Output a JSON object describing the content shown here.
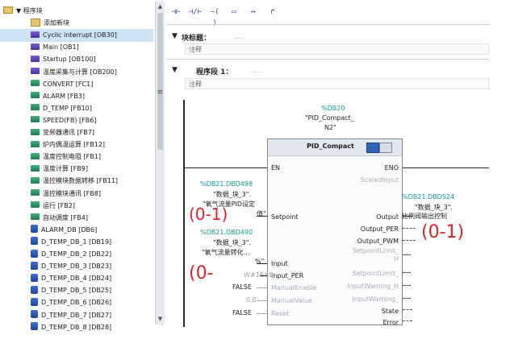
{
  "tree": {
    "items": [
      {
        "label": "▼ 程序块",
        "icon": "folder-icon",
        "kind": "folder",
        "indent": 4
      },
      {
        "label": "添加新块",
        "icon": "add-block-icon",
        "kind": "add",
        "indent": 38
      },
      {
        "label": "Cyclic interrupt [OB30]",
        "icon": "ob-icon",
        "kind": "ob",
        "indent": 38,
        "selected": true
      },
      {
        "label": "Main [OB1]",
        "icon": "ob-icon",
        "kind": "ob",
        "indent": 38
      },
      {
        "label": "Startup [OB100]",
        "icon": "ob-icon",
        "kind": "ob",
        "indent": 38
      },
      {
        "label": "温度采集与计算 [OB200]",
        "icon": "ob-icon",
        "kind": "ob",
        "indent": 38
      },
      {
        "label": "CONVERT [FC1]",
        "icon": "fc-icon",
        "kind": "fc",
        "indent": 38
      },
      {
        "label": "ALARM [FB3]",
        "icon": "fb-icon",
        "kind": "fb",
        "indent": 38
      },
      {
        "label": "D_TEMP [FB10]",
        "icon": "fb-icon",
        "kind": "fb",
        "indent": 38
      },
      {
        "label": "SPEED(FB) [FB6]",
        "icon": "fb-icon",
        "kind": "fb",
        "indent": 38
      },
      {
        "label": "变频器通讯 [FB7]",
        "icon": "fb-icon",
        "kind": "fb",
        "indent": 38
      },
      {
        "label": "炉内偶温运算 [FB12]",
        "icon": "fb-icon",
        "kind": "fb",
        "indent": 38
      },
      {
        "label": "温度控制电阻 [FB1]",
        "icon": "fb-icon",
        "kind": "fb",
        "indent": 38
      },
      {
        "label": "温度计算 [FB9]",
        "icon": "fb-icon",
        "kind": "fb",
        "indent": 38
      },
      {
        "label": "温控模块数据转移 [FB11]",
        "icon": "fb-icon",
        "kind": "fb",
        "indent": 38
      },
      {
        "label": "温控模块通讯 [FB8]",
        "icon": "fb-icon",
        "kind": "fb",
        "indent": 38
      },
      {
        "label": "运行 [FB2]",
        "icon": "fb-icon",
        "kind": "fb",
        "indent": 38
      },
      {
        "label": "自动调度 [FB4]",
        "icon": "fb-icon",
        "kind": "fb",
        "indent": 38
      },
      {
        "label": "ALARM_DB [DB6]",
        "icon": "db-icon",
        "kind": "db",
        "indent": 38
      },
      {
        "label": "D_TEMP_DB_1 [DB19]",
        "icon": "db-icon",
        "kind": "db",
        "indent": 38
      },
      {
        "label": "D_TEMP_DB_2 [DB22]",
        "icon": "db-icon",
        "kind": "db",
        "indent": 38
      },
      {
        "label": "D_TEMP_DB_3 [DB23]",
        "icon": "db-icon",
        "kind": "db",
        "indent": 38
      },
      {
        "label": "D_TEMP_DB_4 [DB24]",
        "icon": "db-icon",
        "kind": "db",
        "indent": 38
      },
      {
        "label": "D_TEMP_DB_5 [DB25]",
        "icon": "db-icon",
        "kind": "db",
        "indent": 38
      },
      {
        "label": "D_TEMP_DB_6 [DB26]",
        "icon": "db-icon",
        "kind": "db",
        "indent": 38
      },
      {
        "label": "D_TEMP_DB_7 [DB27]",
        "icon": "db-icon",
        "kind": "db",
        "indent": 38
      },
      {
        "label": "D_TEMP_DB_8 [DB28]",
        "icon": "db-icon",
        "kind": "db",
        "indent": 38
      }
    ]
  },
  "toolbar": {
    "buttons": [
      "⊣⊢",
      "⊣/⊢",
      "–( )",
      "▭",
      "↦",
      "↱"
    ]
  },
  "block_title": {
    "label": "块标题：",
    "comment_placeholder": "注释",
    "dots": "......"
  },
  "network": {
    "label": "程序段 1：",
    "dots": "......",
    "comment": "注释"
  },
  "instance": {
    "db": "%DB20",
    "name1": "\"PID_Compact_",
    "name2": "N2\""
  },
  "fb": {
    "name": "PID_Compact",
    "left_pins": [
      "EN",
      "Setpoint",
      "Input",
      "Input_PER",
      "ManualEnable",
      "ManualValue",
      "Reset"
    ],
    "right_pins": [
      "ENO",
      "ScaledInput",
      "Output",
      "Output_PER",
      "Output_PWM",
      "SetpointLimit_H",
      "SetpointLimit_L",
      "InputWarning_H",
      "InputWarning_L",
      "State",
      "Error"
    ],
    "right_pins_display": [
      "ENO",
      "ScaledInput",
      "Output",
      "Output_PER",
      "Output_PWM",
      "SetpointLimit_",
      "H",
      "SetpointLimit_",
      "InputWarning_H",
      "InputWarning_",
      "State",
      "Error"
    ]
  },
  "operands": {
    "setpoint_addr": "%DB21.DBD498",
    "setpoint_name1": "\"数据_块_3\".",
    "setpoint_name2": "\"氧气流量PID设定",
    "setpoint_name3": "值\"",
    "input_addr": "%DB21.DBD490",
    "input_name1": "\"数据_块_3\".",
    "input_name2": "\"氧气流量转化...",
    "input_name3": "%\"",
    "input_per_val": "W#16#0",
    "manual_enable_val": "FALSE",
    "manual_value_val": "0.0",
    "reset_val": "FALSE",
    "output_addr": "%DB21.DBD524",
    "output_name1": "\"数据_块_3\".",
    "output_name2": "比例阀输出控制"
  },
  "annotations": {
    "setpoint_range": "(0-1)",
    "output_range": "(0-1)",
    "input_range": "(0-"
  }
}
